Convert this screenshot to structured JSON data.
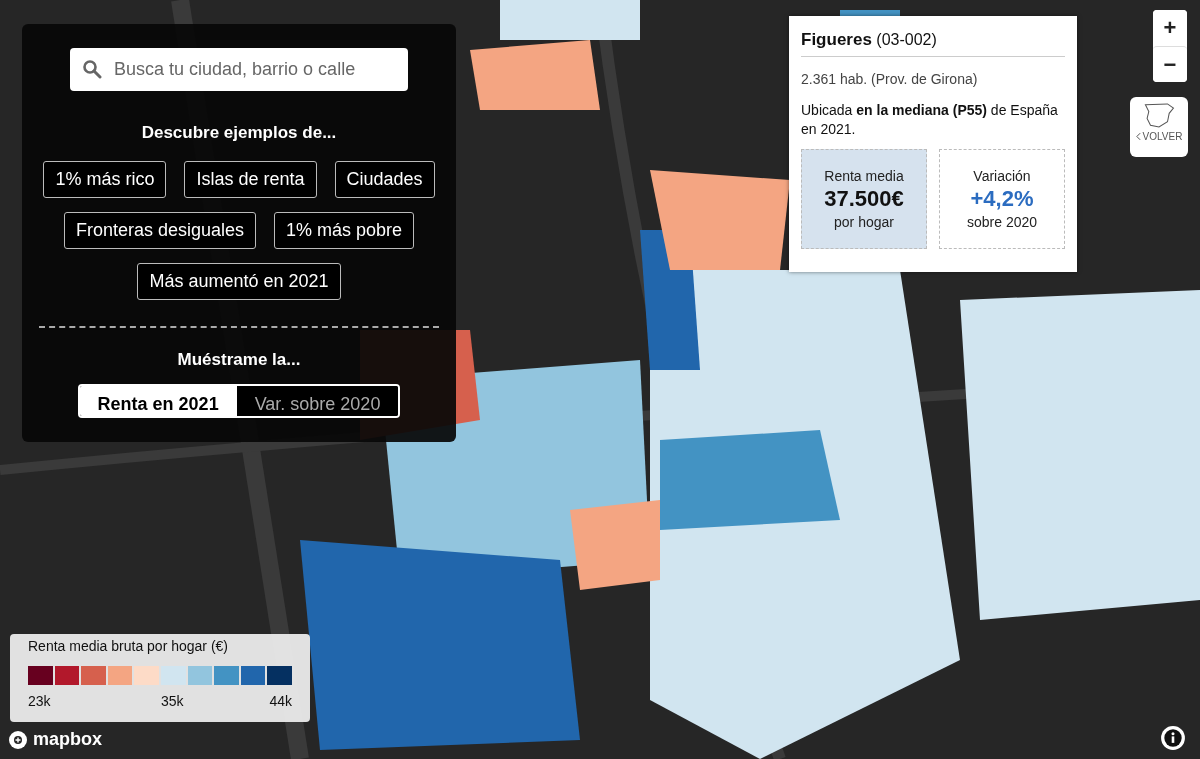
{
  "search": {
    "placeholder": "Busca tu ciudad, barrio o calle"
  },
  "examples": {
    "heading": "Descubre ejemplos de...",
    "buttons": [
      "1% más rico",
      "Islas de renta",
      "Ciudades",
      "Fronteras desiguales",
      "1% más pobre",
      "Más aumentó en 2021"
    ]
  },
  "view": {
    "heading": "Muéstrame la...",
    "options": [
      {
        "label": "Renta en 2021",
        "selected": true
      },
      {
        "label": "Var. sobre 2020",
        "selected": false
      }
    ]
  },
  "popup": {
    "name": "Figueres",
    "code": "(03-002)",
    "population": "2.361 hab. (Prov. de Girona)",
    "description": "Ubicada **en la mediana (P55)** de España en 2021.",
    "stats": [
      {
        "kind": "income",
        "label": "Renta media",
        "value": "37.500€",
        "note": "por hogar"
      },
      {
        "kind": "change",
        "label": "Variación",
        "value": "+4,2%",
        "note": "sobre 2020"
      }
    ]
  },
  "zoom_controls": [
    "+",
    "−"
  ],
  "back_button": {
    "label": "VOLVER"
  },
  "legend": {
    "title": "Renta media bruta por hogar (€)",
    "swatches": [
      {
        "color": "#67001f"
      },
      {
        "color": "#b2182b"
      },
      {
        "color": "#d6604d"
      },
      {
        "color": "#f4a582"
      },
      {
        "color": "#fddbc7"
      },
      {
        "color": "#d1e5f0"
      },
      {
        "color": "#92c5de"
      },
      {
        "color": "#4393c3"
      },
      {
        "color": "#2166ac"
      },
      {
        "color": "#053061"
      }
    ],
    "ticks": [
      "23k",
      "35k",
      "44k"
    ]
  },
  "attribution": {
    "logo_text": "mapbox"
  }
}
